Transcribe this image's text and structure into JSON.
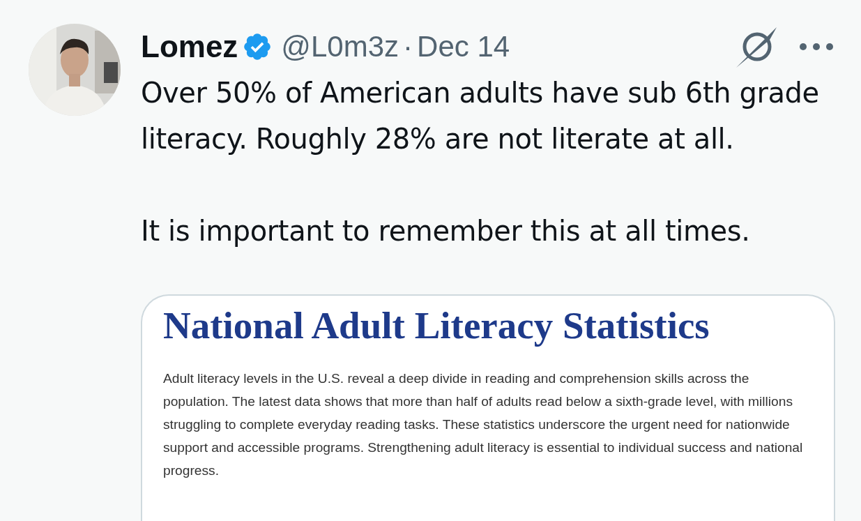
{
  "author": {
    "name": "Lomez",
    "verified": true,
    "handle": "@L0m3z",
    "separator": "·",
    "date": "Dec 14"
  },
  "text": [
    "Over 50% of American adults have sub 6th grade literacy. Roughly 28% are not literate at all.",
    "It is important to remember this at all times."
  ],
  "media": {
    "title": "National Adult Literacy Statistics",
    "paragraph": "Adult literacy levels in the U.S. reveal a deep divide in reading and comprehension skills across the population. The latest data shows that more than half of adults read below a sixth-grade level, with millions struggling to complete everyday reading tasks. These statistics underscore the urgent need for nationwide support and accessible programs. Strengthening adult literacy is essential to individual success and national progress."
  }
}
